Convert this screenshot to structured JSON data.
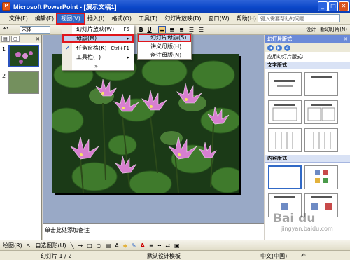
{
  "window": {
    "title": "Microsoft PowerPoint - [演示文稿1]",
    "buttons": [
      "_",
      "□",
      "✕"
    ]
  },
  "menubar": {
    "items": [
      "文件(F)",
      "编辑(E)",
      "视图(V)",
      "插入(I)",
      "格式(O)",
      "工具(T)",
      "幻灯片放映(D)",
      "窗口(W)",
      "帮助(H)"
    ],
    "help_placeholder": "键入需要帮助的问题"
  },
  "toolbar": {
    "font": "宋体",
    "bold": "B",
    "underline": "U",
    "design_label": "设计",
    "new_slide_label": "新幻灯片(N)"
  },
  "view_menu": {
    "items": [
      {
        "label": "幻灯片放映(W)",
        "shortcut": "F5"
      },
      {
        "label": "母版(M)",
        "shortcut": "▸"
      },
      {
        "label": "任务窗格(K)",
        "shortcut": "Ctrl+F1"
      },
      {
        "label": "工具栏(T)",
        "shortcut": "▸"
      },
      {
        "label": "»",
        "shortcut": ""
      }
    ]
  },
  "master_submenu": {
    "items": [
      "幻灯片母版(S)",
      "讲义母版(H)",
      "备注母版(N)"
    ]
  },
  "slides_panel": {
    "numbers": [
      "1",
      "2"
    ]
  },
  "notes": {
    "placeholder": "单击此处添加备注"
  },
  "task_pane": {
    "title": "幻灯片版式",
    "close": "✕",
    "apply_label": "应用幻灯片版式:",
    "group_text": "文字版式",
    "group_content": "内容版式"
  },
  "drawing_toolbar": {
    "draw_label": "绘图(R)",
    "autoshapes_label": "自选图形(U)"
  },
  "status": {
    "slide": "幻灯片 1 / 2",
    "design": "默认设计模板",
    "language": "中文(中国)"
  },
  "watermark": {
    "text": "Bai du",
    "sub": "jingyan.baidu.com"
  }
}
